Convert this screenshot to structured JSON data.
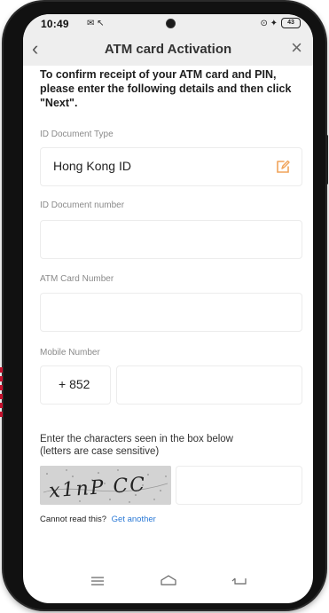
{
  "status_bar": {
    "time": "10:49",
    "left_icons": "✉ ↖",
    "right_icons": "⊙ ✦",
    "battery": "43"
  },
  "header": {
    "back": "‹",
    "title": "ATM card Activation",
    "close": "×"
  },
  "instructions": "To confirm receipt of your ATM card and PIN, please enter the following details and then click \"Next\".",
  "form": {
    "id_type_label": "ID Document Type",
    "id_type_value": "Hong Kong ID",
    "id_number_label": "ID Document number",
    "id_number_value": "",
    "atm_label": "ATM Card Number",
    "atm_value": "",
    "mobile_label": "Mobile Number",
    "country_code": "+ 852",
    "mobile_value": ""
  },
  "captcha": {
    "instruction": "Enter the characters seen in the box below\n (letters are case sensitive)",
    "image_text": "x1nP CC",
    "input_value": "",
    "cannot_read": "Cannot read this?",
    "get_another": "Get another"
  },
  "colors": {
    "header_bg": "#eeeeee",
    "link": "#2a79d6",
    "edit_icon": "#f0a35a",
    "label": "#8a8a8a"
  },
  "icons": {
    "edit": "edit-icon",
    "nav_menu": "menu-icon",
    "nav_home": "home-icon",
    "nav_back": "back-icon"
  }
}
